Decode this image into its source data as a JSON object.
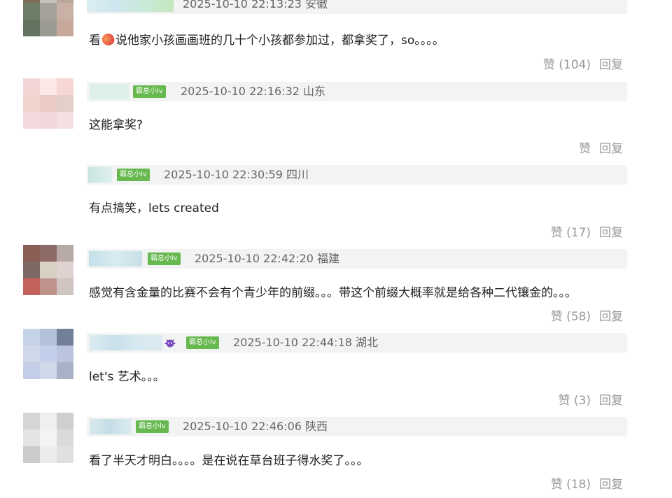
{
  "colors": {
    "meta_bg": "#f2f4f3",
    "badge_bg": "#66b84f",
    "muted_text": "#999999",
    "time_text": "#666666"
  },
  "comments": [
    {
      "text_before_emoji": "看",
      "emoji": "mango-emoji",
      "text": "说他家小孩画画班的几十个小孩都参加过，都拿奖了，so。。。。",
      "time": "2025-10-10 22:13:23 安徽",
      "like": "赞 (104)",
      "reply": "回复",
      "badge": ""
    },
    {
      "text": "这能拿奖?",
      "time": "2025-10-10 22:16:32 山东",
      "like": "赞",
      "reply": "回复",
      "badge": "霸总小lv"
    },
    {
      "text": "有点搞笑，lets created",
      "time": "2025-10-10 22:30:59 四川",
      "like": "赞 (17)",
      "reply": "回复",
      "badge": "霸总小lv"
    },
    {
      "text": "感觉有含金量的比赛不会有个青少年的前缀。。。带这个前缀大概率就是给各种二代镶金的。。。",
      "time": "2025-10-10 22:42:20 福建",
      "like": "赞 (58)",
      "reply": "回复",
      "badge": "霸总小lv"
    },
    {
      "text": "let's 艺术。。。",
      "time": "2025-10-10 22:44:18 湖北",
      "like": "赞 (3)",
      "reply": "回复",
      "badge": "霸总小lv",
      "icon": "purple-devil-icon"
    },
    {
      "text": "看了半天才明白。。。。是在说在草台班子得水奖了。。。",
      "time": "2025-10-10 22:46:06 陕西",
      "like": "赞 (18)",
      "reply": "回复",
      "badge": "霸总小lv"
    }
  ]
}
